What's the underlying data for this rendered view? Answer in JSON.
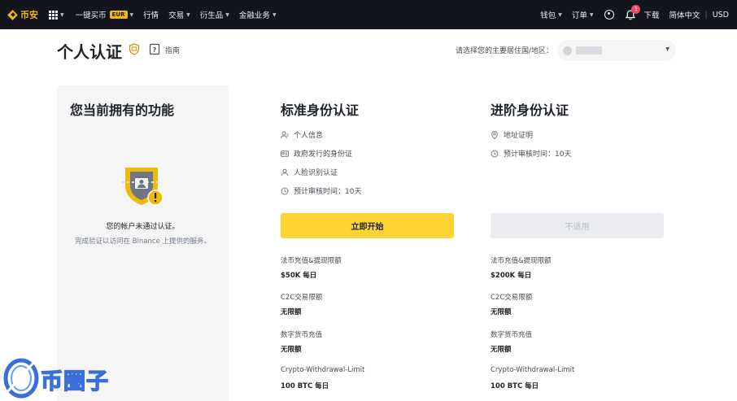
{
  "topbar": {
    "logo_text": "币安",
    "nav": [
      {
        "label": "一键买币",
        "badge": "EUR"
      },
      {
        "label": "行情"
      },
      {
        "label": "交易"
      },
      {
        "label": "衍生品"
      },
      {
        "label": "金融业务"
      }
    ],
    "wallet": "钱包",
    "orders": "订单",
    "notification_count": "1",
    "download": "下载",
    "language": "简体中文",
    "separator": "|",
    "currency": "USD"
  },
  "header": {
    "title": "个人认证",
    "guide": "指南",
    "country_label": "请选择您的主要居住国/地区："
  },
  "features": {
    "title": "您当前拥有的功能",
    "status": "您的帐户未通过认证。",
    "hint": "完成验证以访问在 Binance 上提供的服务。"
  },
  "standard": {
    "title": "标准身份认证",
    "requirements": [
      {
        "icon": "person-info-icon",
        "text": "个人信息"
      },
      {
        "icon": "id-card-icon",
        "text": "政府发行的身份证"
      },
      {
        "icon": "face-recognition-icon",
        "text": "人脸识别认证"
      },
      {
        "icon": "clock-icon",
        "text": "预计审核时间：10天"
      }
    ],
    "button": "立即开始",
    "limits": [
      {
        "label": "法币充值&提现限额",
        "value": "$50K 每日"
      },
      {
        "label": "C2C交易限额",
        "value": "无限额"
      },
      {
        "label": "数字货币充值",
        "value": "无限额"
      },
      {
        "label": "Crypto-Withdrawal-Limit",
        "value": "100 BTC 每日"
      }
    ]
  },
  "advanced": {
    "title": "进阶身份认证",
    "requirements": [
      {
        "icon": "location-pin-icon",
        "text": "地址证明"
      },
      {
        "icon": "clock-icon",
        "text": "预计审核时间：10天"
      }
    ],
    "button": "不适用",
    "limits": [
      {
        "label": "法币充值&提现限额",
        "value": "$200K 每日"
      },
      {
        "label": "C2C交易限额",
        "value": "无限额"
      },
      {
        "label": "数字货币充值",
        "value": "无限额"
      },
      {
        "label": "Crypto-Withdrawal-Limit",
        "value": "100 BTC 每日"
      }
    ]
  },
  "watermark": {
    "text": "币圈子"
  },
  "colors": {
    "brand": "#f0b90b",
    "primary_button": "#fcd535",
    "topbar": "#12161c",
    "alert": "#f6465d"
  }
}
